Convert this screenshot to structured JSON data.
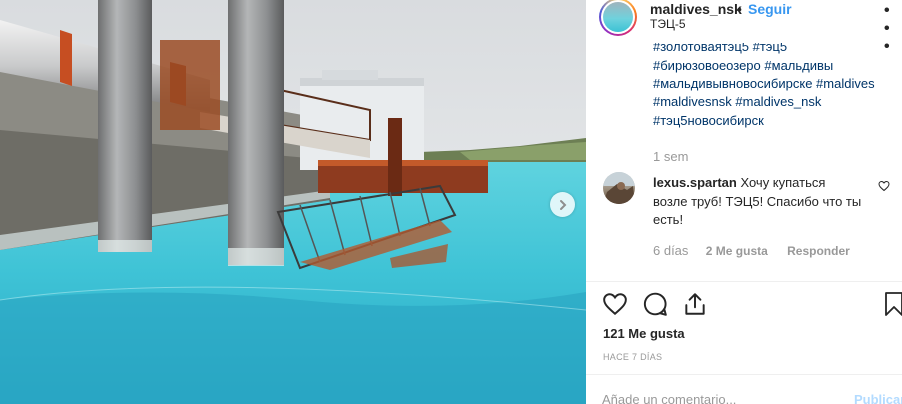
{
  "post": {
    "username": "maldives_nsk",
    "separator": "•",
    "follow_label": "Seguir",
    "location": "ТЭЦ-5",
    "more_glyph": "• • •",
    "hashtags_cut": "#золотоваятэц5 #тэц5",
    "hashtags": [
      "#бирюзовоеозеро",
      "#мальдивы",
      "#мальдивывновосибирске",
      "#maldives",
      "#maldivesnsk",
      "#maldives_nsk",
      "#тэц5новосибирск"
    ],
    "caption_time": "1 sem"
  },
  "comment": {
    "username": "lexus.spartan",
    "text": "Хочу купаться возле труб! ТЭЦ5! Спасибо что ты есть!",
    "time": "6 días",
    "likes": "2 Me gusta",
    "reply_label": "Responder"
  },
  "footer": {
    "likes": "121 Me gusta",
    "posted_ago": "HACE 7 DÍAS",
    "comment_placeholder": "Añade un comentario...",
    "publish_label": "Publicar"
  },
  "icons": {
    "like": "heart-icon",
    "comment": "comment-icon",
    "share": "share-icon",
    "save": "bookmark-icon",
    "next": "chevron-right-icon",
    "comment_like": "heart-icon"
  },
  "colors": {
    "link": "#003569",
    "follow": "#3897f0",
    "muted": "#999999",
    "water": "#3fc3d6"
  }
}
